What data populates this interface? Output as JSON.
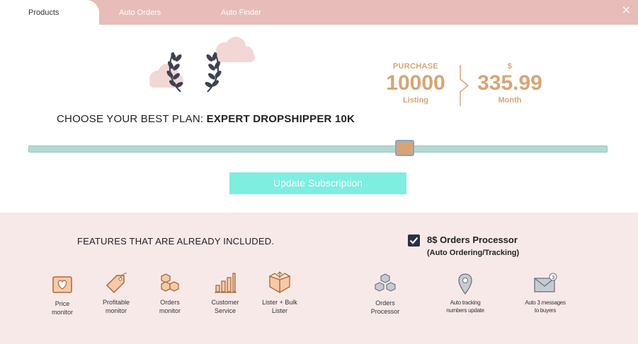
{
  "tabs": [
    {
      "label": "Products",
      "active": true
    },
    {
      "label": "Auto Orders",
      "active": false
    },
    {
      "label": "Auto Finder",
      "active": false
    }
  ],
  "close_label": "×",
  "plan": {
    "prefix": "CHOOSE YOUR BEST PLAN: ",
    "name": "EXPERT DROPSHIPPER 10K"
  },
  "purchase": {
    "caption": "PURCHASE",
    "value": "10000",
    "unit": "Listing"
  },
  "price": {
    "caption": "$",
    "value": "335.99",
    "unit": "Month"
  },
  "slider": {
    "fraction": 0.65
  },
  "update_button": "Update Subscription",
  "features": {
    "title": "FEATURES THAT ARE ALREADY INCLUDED.",
    "items": [
      {
        "label": "Price\nmonitor",
        "icon": "price-tag-heart-icon"
      },
      {
        "label": "Profitable\nmonitor",
        "icon": "tag-icon"
      },
      {
        "label": "Orders\nmonitor",
        "icon": "boxes-icon"
      },
      {
        "label": "Customer\nService",
        "icon": "bar-chart-icon"
      },
      {
        "label": "Lister + Bulk\nLister",
        "icon": "open-box-icon"
      }
    ]
  },
  "processor": {
    "title": "8$ Orders Processor",
    "subtitle": "(Auto Ordering/Tracking)",
    "checked": true,
    "items": [
      {
        "label": "Orders\nProcessor",
        "icon": "cubes-icon"
      },
      {
        "label": "Auto tracking\nnumbers update",
        "icon": "map-pin-icon"
      },
      {
        "label": "Auto 3 messages\nto buyers",
        "icon": "envelope-icon",
        "badge": "3"
      }
    ]
  },
  "colors": {
    "tab_bar": "#e8bcb8",
    "accent": "#d7a574",
    "slider_track": "#b4d8d2",
    "button": "#7eeee0",
    "panel": "#f8e9e9",
    "checkbox": "#2b2f4a"
  }
}
